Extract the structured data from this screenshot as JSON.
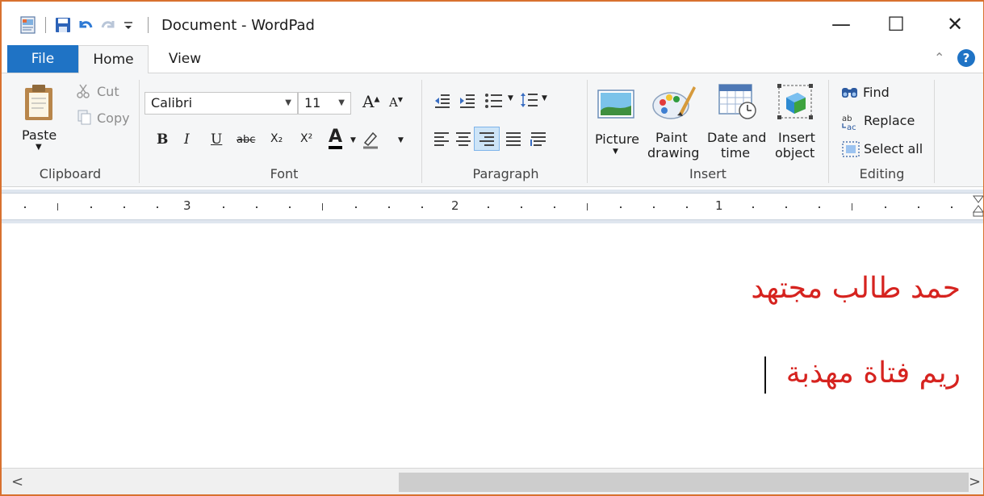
{
  "window": {
    "title": "Document - WordPad",
    "minimize_glyph": "—",
    "maximize_glyph": "☐",
    "close_glyph": "✕",
    "accent_color": "#1f73c5",
    "border_color": "#d8712f"
  },
  "tabs": {
    "file": "File",
    "home": "Home",
    "view": "View"
  },
  "clipboard": {
    "paste": "Paste",
    "cut": "Cut",
    "copy": "Copy",
    "label": "Clipboard"
  },
  "font": {
    "family": "Calibri",
    "size": "11",
    "label": "Font",
    "bold": "B",
    "italic": "I",
    "underline": "U",
    "strike": "abc",
    "subscript": "X₂",
    "superscript": "X²",
    "color_letter": "A",
    "grow": "A",
    "shrink": "A"
  },
  "paragraph": {
    "label": "Paragraph"
  },
  "insert": {
    "picture": "Picture",
    "paint_line1": "Paint",
    "paint_line2": "drawing",
    "date_line1": "Date and",
    "date_line2": "time",
    "object_line1": "Insert",
    "object_line2": "object",
    "label": "Insert"
  },
  "editing": {
    "find": "Find",
    "replace": "Replace",
    "select_all": "Select all",
    "label": "Editing"
  },
  "ruler": {
    "numbers": [
      "3",
      "2",
      "1"
    ]
  },
  "document": {
    "line1": "حمد طالب مجتهد",
    "line2": "ريم فتاة مهذبة",
    "text_color": "#d6231f"
  },
  "scrollbar": {
    "left": "<",
    "right": ">"
  }
}
